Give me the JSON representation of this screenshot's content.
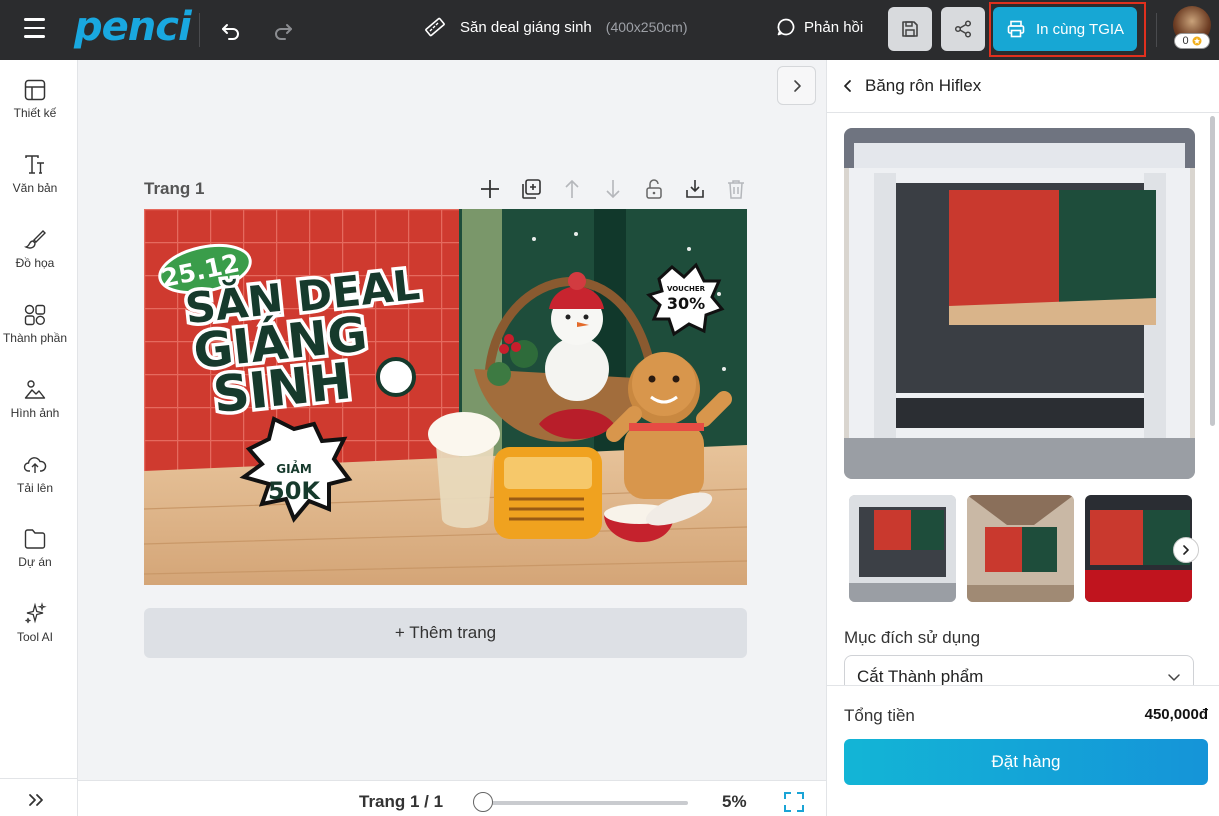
{
  "app": {
    "logo": "penci",
    "title": "Săn deal giáng sinh",
    "size": "(400x250cm)"
  },
  "toolbar": {
    "feedback_label": "Phản hồi",
    "print_label": "In cùng TGIA",
    "coins": "0"
  },
  "sidebar": {
    "items": [
      {
        "label": "Thiết kế",
        "icon": "layout-icon"
      },
      {
        "label": "Văn bản",
        "icon": "text-icon"
      },
      {
        "label": "Đồ họa",
        "icon": "brush-icon"
      },
      {
        "label": "Thành phần",
        "icon": "shapes-icon"
      },
      {
        "label": "Hình ảnh",
        "icon": "image-icon"
      },
      {
        "label": "Tải lên",
        "icon": "upload-icon"
      },
      {
        "label": "Dự án",
        "icon": "folder-icon"
      },
      {
        "label": "Tool AI",
        "icon": "sparkle-icon"
      }
    ]
  },
  "canvas": {
    "page_label": "Trang 1",
    "add_page_label": "+ Thêm trang",
    "design": {
      "badge": "25.12",
      "headline_1": "SĂN DEAL",
      "headline_2": "GIÁNG",
      "headline_3": "SINH",
      "discount_top": "GIẢM",
      "discount_value": "50K",
      "voucher_top": "VOUCHER",
      "voucher_value": "30%"
    }
  },
  "footer": {
    "page_count": "Trang 1 / 1",
    "zoom": "5%",
    "zoom_fraction": 0.0
  },
  "panel": {
    "title": "Băng rôn Hiflex",
    "purpose_label": "Mục đích sử dụng",
    "purpose_value": "Cắt Thành phẩm",
    "total_label": "Tổng tiền",
    "total_value": "450,000đ",
    "order_label": "Đặt hàng"
  },
  "colors": {
    "topbar": "#2b2c2e",
    "accent": "#17a7d4",
    "highlight_border": "#e0301e",
    "design_red": "#c8332b",
    "design_green": "#1e4d3b"
  }
}
